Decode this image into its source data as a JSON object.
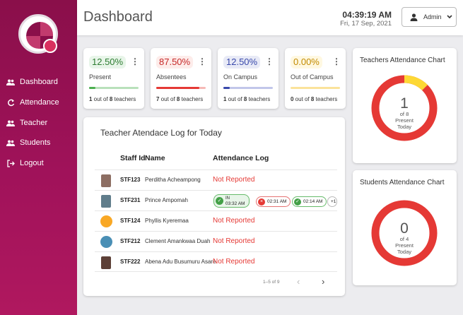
{
  "sidebar": {
    "items": [
      {
        "label": "Dashboard",
        "icon": "people-icon"
      },
      {
        "label": "Attendance",
        "icon": "refresh-icon"
      },
      {
        "label": "Teacher",
        "icon": "people-icon"
      },
      {
        "label": "Students",
        "icon": "people-icon"
      },
      {
        "label": "Logout",
        "icon": "logout-icon"
      }
    ]
  },
  "header": {
    "title": "Dashboard",
    "time": "04:39:19 AM",
    "date": "Fri, 17 Sep, 2021",
    "user_label": "Admin"
  },
  "stats": [
    {
      "pct": "12.50%",
      "label": "Present",
      "footer_a": "1",
      "footer_mid": " out of ",
      "footer_b": "8",
      "footer_c": " teachers",
      "fill": 0.125,
      "color": "#4caf50",
      "bg": "#e8f5e9",
      "track": "#b9e1bb",
      "text_color": "#2e7d32"
    },
    {
      "pct": "87.50%",
      "label": "Absentees",
      "footer_a": "7",
      "footer_mid": " out of ",
      "footer_b": "8",
      "footer_c": " teachers",
      "fill": 0.875,
      "color": "#e53935",
      "bg": "#fdecea",
      "track": "#f6b9b6",
      "text_color": "#c62828"
    },
    {
      "pct": "12.50%",
      "label": "On Campus",
      "footer_a": "1",
      "footer_mid": " out of ",
      "footer_b": "8",
      "footer_c": " teachers",
      "fill": 0.125,
      "color": "#3949ab",
      "bg": "#e8eaf6",
      "track": "#c1c6ea",
      "text_color": "#3949ab"
    },
    {
      "pct": "0.00%",
      "label": "Out of Campus",
      "footer_a": "0",
      "footer_mid": " out of ",
      "footer_b": "8",
      "footer_c": " teachers",
      "fill": 0.0,
      "color": "#fbc02d",
      "bg": "#fff8e1",
      "track": "#fbe39a",
      "text_color": "#c28a00"
    }
  ],
  "log": {
    "title": "Teacher Atendace Log for Today",
    "col_staff_id": "Staff Id",
    "col_name": "Name",
    "col_log": "Attendance Log",
    "rows": [
      {
        "id": "STF123",
        "name": "Perditha Acheampong",
        "status": "Not Reported",
        "avatar": "#8d6e63",
        "round": false
      },
      {
        "id": "STF231",
        "name": "Prince Ampomah",
        "status": "",
        "avatar": "#607d8b",
        "round": false
      },
      {
        "id": "STF124",
        "name": "Phyllis Kyeremaa",
        "status": "Not Reported",
        "avatar": "#f9a825",
        "round": true
      },
      {
        "id": "STF212",
        "name": "Clement Amankwaa Duah",
        "status": "Not Reported",
        "avatar": "#4a8fb5",
        "round": true
      },
      {
        "id": "STF222",
        "name": "Abena Adu Busumuru Asare",
        "status": "Not Reported",
        "avatar": "#5d4037",
        "round": false
      }
    ],
    "chips": {
      "in_label": "IN",
      "in_time": "03:32 AM",
      "chip2": "02:31 AM",
      "chip3": "02:14 AM",
      "more": "+1"
    },
    "pagination": "1–5 of 9",
    "prev": "‹",
    "next": "›"
  },
  "teachers_chart": {
    "title": "Teachers Attendance Chart",
    "count": "1",
    "of_text": "of 8",
    "line1": "Present",
    "line2": "Today",
    "present": 1,
    "total": 8,
    "present_color": "#fdd835",
    "absent_color": "#e53935"
  },
  "students_chart": {
    "title": "Students Attendance Chart",
    "count": "0",
    "of_text": "of 4",
    "line1": "Present",
    "line2": "Today",
    "present": 0,
    "total": 4,
    "present_color": "#fdd835",
    "absent_color": "#e53935"
  }
}
